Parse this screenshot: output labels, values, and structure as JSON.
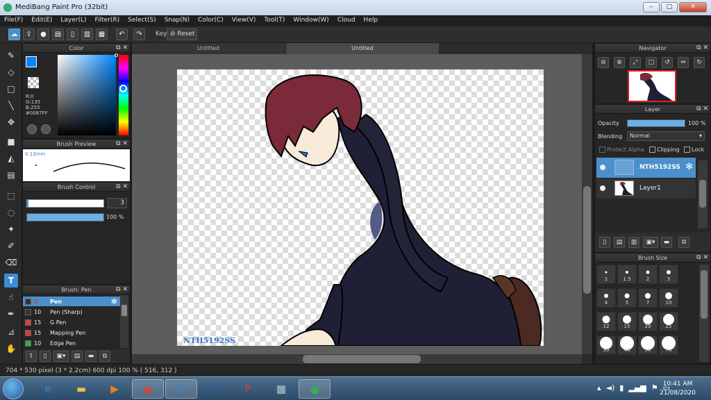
{
  "window": {
    "title": "MediBang Paint Pro (32bit)"
  },
  "menu": [
    "File(F)",
    "Edit(E)",
    "Layer(L)",
    "Filter(R)",
    "Select(S)",
    "Snap(N)",
    "Color(C)",
    "View(V)",
    "Tool(T)",
    "Window(W)",
    "Cloud",
    "Help"
  ],
  "toolbar": {
    "key_label": "Key",
    "reset_label": "Reset"
  },
  "tabs": [
    "Untitled",
    "Untitled"
  ],
  "color_panel": {
    "title": "Color",
    "r": "R:0",
    "g": "G:135",
    "b": "B:255",
    "hex": "#0087FF",
    "fg": "#0087ff",
    "bg": "#ffffff"
  },
  "brush_preview": {
    "title": "Brush Preview",
    "size": "0.13mm"
  },
  "brush_control": {
    "title": "Brush Control",
    "size_value": "3",
    "size_fraction": 0.02,
    "opacity_value": "100 %",
    "opacity_fraction": 1.0
  },
  "brush_list": {
    "title": "Brush: Pen",
    "items": [
      {
        "size": "3",
        "name": "Pen",
        "color": "#333333",
        "selected": true
      },
      {
        "size": "10",
        "name": "Pen (Sharp)",
        "color": "#333333",
        "selected": false
      },
      {
        "size": "15",
        "name": "G Pen",
        "color": "#e23a3a",
        "selected": false
      },
      {
        "size": "15",
        "name": "Mapping Pen",
        "color": "#e23a3a",
        "selected": false
      },
      {
        "size": "10",
        "name": "Edge Pen",
        "color": "#35b13a",
        "selected": false
      }
    ]
  },
  "navigator": {
    "title": "Navigator"
  },
  "layer_panel": {
    "title": "Layer",
    "opacity_label": "Opacity",
    "opacity_value": "100 %",
    "opacity_fraction": 1.0,
    "blending_label": "Blending",
    "blending_value": "Normal",
    "protect_alpha": "Protect Alpha",
    "clipping": "Clipping",
    "lock": "Lock",
    "layers": [
      {
        "name": "NTH5192SS",
        "selected": true
      },
      {
        "name": "Layer1",
        "selected": false
      }
    ]
  },
  "brush_size": {
    "title": "Brush Size",
    "sizes": [
      "1",
      "1.5",
      "2",
      "3",
      "4",
      "5",
      "7",
      "10",
      "12",
      "15",
      "20",
      "25",
      "30",
      "40",
      "50",
      "70"
    ]
  },
  "canvas_text": "NTH5192SS",
  "status": {
    "text": "704 * 530 pixel   (3 * 2.2cm)   600 dpi   100 %   ( 516, 312 )"
  },
  "clock": {
    "time": "10:41 AM",
    "date": "21/08/2020"
  },
  "taskbar_apps": [
    {
      "name": "ie-icon",
      "glyph": "e",
      "color": "#2a8be0"
    },
    {
      "name": "explorer-icon",
      "glyph": "▬",
      "color": "#e8c050"
    },
    {
      "name": "media-icon",
      "glyph": "▶",
      "color": "#f08020"
    },
    {
      "name": "chrome-icon",
      "glyph": "◉",
      "color": "#e04030"
    },
    {
      "name": "zalo-icon",
      "glyph": "Z",
      "color": "#1e88e5"
    },
    {
      "name": "word-icon",
      "glyph": "W",
      "color": "#2b579a"
    },
    {
      "name": "powerpoint-icon",
      "glyph": "P",
      "color": "#d24726"
    },
    {
      "name": "calculator-icon",
      "glyph": "▦",
      "color": "#bcc"
    },
    {
      "name": "medibang-icon",
      "glyph": "●",
      "color": "#3aaa5a"
    }
  ]
}
